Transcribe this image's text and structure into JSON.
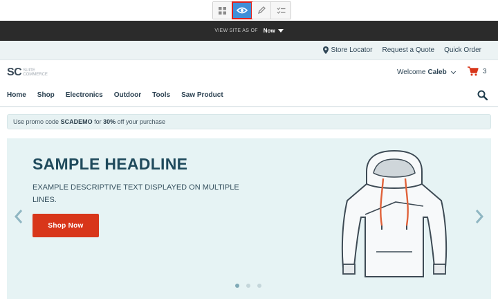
{
  "editor_toolbar": {
    "buttons": [
      {
        "icon": "grid-icon"
      },
      {
        "icon": "eye-icon",
        "active": true
      },
      {
        "icon": "pencil-icon"
      },
      {
        "icon": "checklist-icon"
      }
    ]
  },
  "view_bar": {
    "label": "VIEW SITE AS OF",
    "value": "Now"
  },
  "utility_links": {
    "store_locator": "Store Locator",
    "request_quote": "Request a Quote",
    "quick_order": "Quick Order"
  },
  "header": {
    "logo_main": "SC",
    "logo_line1": "SUITE",
    "logo_line2": "COMMERCE",
    "welcome_prefix": "Welcome",
    "user_name": "Caleb",
    "cart_count": "3"
  },
  "nav": {
    "items": [
      "Home",
      "Shop",
      "Electronics",
      "Outdoor",
      "Tools",
      "Saw Product"
    ]
  },
  "promo": {
    "prefix": "Use promo code",
    "code": "SCADEMO",
    "middle": "for",
    "discount": "30%",
    "suffix": "off your purchase"
  },
  "hero": {
    "headline": "SAMPLE HEADLINE",
    "description": "EXAMPLE DESCRIPTIVE TEXT DISPLAYED ON MULTIPLE LINES.",
    "button_label": "Shop Now",
    "slide_count": 3,
    "active_slide": 1
  },
  "colors": {
    "accent_blue": "#3f8fd8",
    "brand_red": "#d8361a",
    "dark_bar": "#2b2b2b",
    "headline": "#1f4a5c",
    "hero_bg": "#e6f3f4"
  }
}
